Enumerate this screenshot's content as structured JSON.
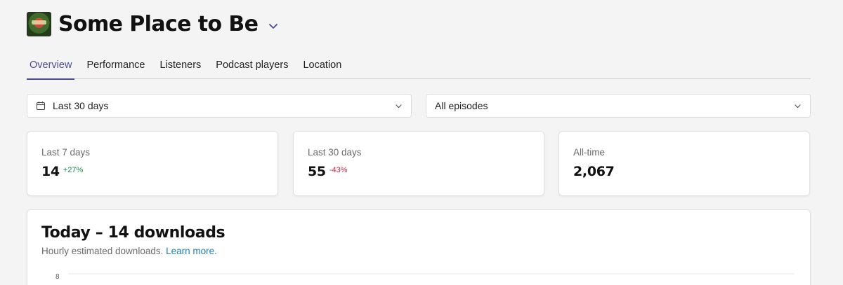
{
  "header": {
    "title": "Some Place to Be",
    "logo_icon": "podcast-cover-art",
    "dropdown_icon": "chevron-down-icon"
  },
  "tabs": [
    {
      "label": "Overview",
      "active": true
    },
    {
      "label": "Performance",
      "active": false
    },
    {
      "label": "Listeners",
      "active": false
    },
    {
      "label": "Podcast players",
      "active": false
    },
    {
      "label": "Location",
      "active": false
    }
  ],
  "filters": {
    "range": {
      "value": "Last 30 days",
      "icon": "calendar-icon"
    },
    "episodes": {
      "value": "All episodes"
    }
  },
  "stats": [
    {
      "label": "Last 7 days",
      "value": "14",
      "change": "+27%",
      "trend": "up"
    },
    {
      "label": "Last 30 days",
      "value": "55",
      "change": "-43%",
      "trend": "down"
    },
    {
      "label": "All-time",
      "value": "2,067",
      "change": "",
      "trend": "none"
    }
  ],
  "chart": {
    "title": "Today – 14 downloads",
    "subtitle": "Hourly estimated downloads.",
    "link": "Learn more.",
    "y_tick_top": "8"
  },
  "colors": {
    "accent": "#4a4a9a",
    "positive": "#1f8a4c",
    "negative": "#c8243a",
    "link": "#1d7fa8"
  }
}
